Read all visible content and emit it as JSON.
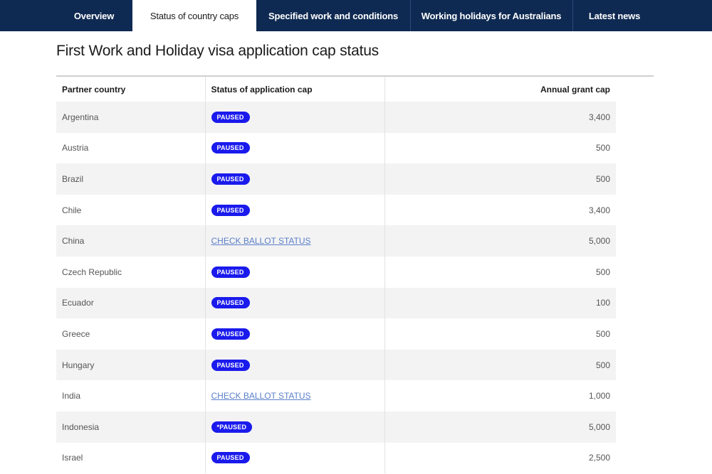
{
  "nav": {
    "tabs": [
      {
        "label": "Overview",
        "active": false
      },
      {
        "label": "Status of country caps",
        "active": true
      },
      {
        "label": "Specified work and conditions",
        "active": false
      },
      {
        "label": "Working holidays for Australians",
        "active": false
      },
      {
        "label": "Latest news",
        "active": false
      }
    ]
  },
  "page": {
    "title": "First Work and Holiday visa application cap status"
  },
  "table": {
    "headers": [
      "Partner country",
      "Status of application cap",
      "Annual grant cap"
    ],
    "rows": [
      {
        "country": "Argentina",
        "status": "PAUSED",
        "status_type": "badge",
        "cap": "3,400"
      },
      {
        "country": "Austria",
        "status": "PAUSED",
        "status_type": "badge",
        "cap": "500"
      },
      {
        "country": "Brazil",
        "status": "PAUSED",
        "status_type": "badge",
        "cap": "500"
      },
      {
        "country": "Chile",
        "status": "PAUSED",
        "status_type": "badge",
        "cap": "3,400"
      },
      {
        "country": "China",
        "status": "CHECK BALLOT STATUS",
        "status_type": "link",
        "cap": "5,000"
      },
      {
        "country": "Czech Republic",
        "status": "PAUSED",
        "status_type": "badge",
        "cap": "500"
      },
      {
        "country": "Ecuador",
        "status": "PAUSED",
        "status_type": "badge",
        "cap": "100"
      },
      {
        "country": "Greece",
        "status": "PAUSED",
        "status_type": "badge",
        "cap": "500"
      },
      {
        "country": "Hungary",
        "status": "PAUSED",
        "status_type": "badge",
        "cap": "500"
      },
      {
        "country": "India",
        "status": "CHECK BALLOT STATUS",
        "status_type": "link",
        "cap": "1,000"
      },
      {
        "country": "Indonesia",
        "status": "*PAUSED",
        "status_type": "badge",
        "cap": "5,000"
      },
      {
        "country": "Israel",
        "status": "PAUSED",
        "status_type": "badge",
        "cap": "2,500"
      }
    ]
  },
  "colors": {
    "nav_bg": "#0f2a52",
    "badge_bg": "#1a1aed",
    "link": "#5a7fc9",
    "row_alt": "#f3f3f3"
  }
}
